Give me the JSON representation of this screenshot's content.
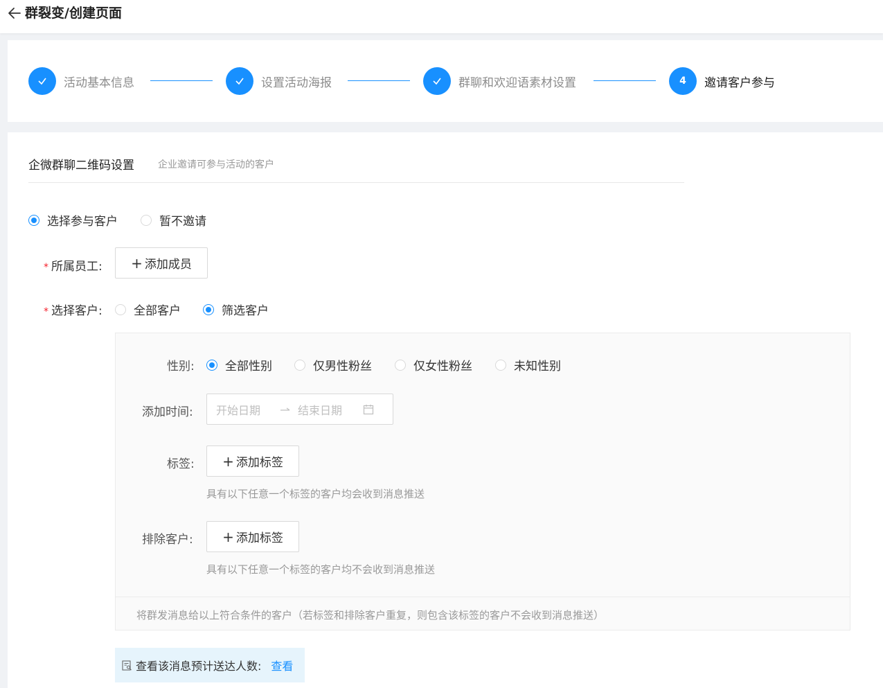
{
  "header": {
    "title": "群裂变/创建页面"
  },
  "steps": [
    {
      "label": "活动基本信息",
      "state": "done"
    },
    {
      "label": "设置活动海报",
      "state": "done"
    },
    {
      "label": "群聊和欢迎语素材设置",
      "state": "done"
    },
    {
      "label": "邀请客户参与",
      "state": "active",
      "number": "4"
    }
  ],
  "section": {
    "title": "企微群聊二维码设置",
    "subtitle": "企业邀请可参与活动的客户"
  },
  "invite_mode": {
    "options": [
      "选择参与客户",
      "暂不邀请"
    ],
    "selected": "选择参与客户"
  },
  "staff": {
    "label": "所属员工:",
    "button": "添加成员"
  },
  "customer_select": {
    "label": "选择客户:",
    "options": [
      "全部客户",
      "筛选客户"
    ],
    "selected": "筛选客户"
  },
  "filter": {
    "gender_label": "性别:",
    "gender_options": [
      "全部性别",
      "仅男性粉丝",
      "仅女性粉丝",
      "未知性别"
    ],
    "gender_selected": "全部性别",
    "time_label": "添加时间:",
    "start_placeholder": "开始日期",
    "end_placeholder": "结束日期",
    "tag_label": "标签:",
    "tag_button": "添加标签",
    "tag_hint": "具有以下任意一个标签的客户均会收到消息推送",
    "exclude_label": "排除客户:",
    "exclude_button": "添加标签",
    "exclude_hint": "具有以下任意一个标签的客户均不会收到消息推送",
    "footer": "将群发消息给以上符合条件的客户（若标签和排除客户重复，则包含该标签的客户不会收到消息推送）"
  },
  "preview": {
    "text": "查看该消息预计送达人数:",
    "link": "查看"
  },
  "colors": {
    "primary": "#1890ff",
    "required": "#f5222d"
  }
}
